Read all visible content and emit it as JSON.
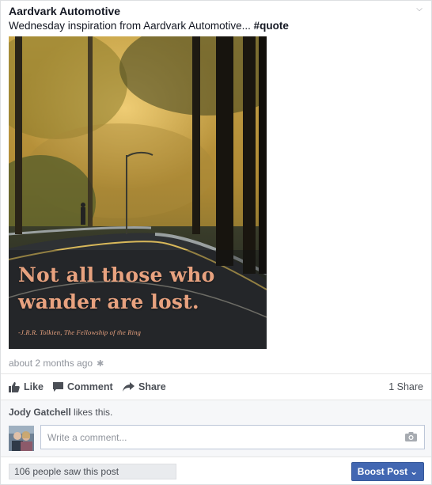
{
  "post": {
    "page_name": "Aardvark Automotive",
    "caption_text": "Wednesday inspiration from Aardvark Automotive... ",
    "caption_hashtag": "#quote",
    "options_icon": "chevron-down-icon",
    "photo": {
      "quote_line_1": "Not all those who",
      "quote_line_2": "wander are lost.",
      "attribution": "-J.R.R. Tolkien, The Fellowship of the Ring",
      "quote_color": "#e8a27f"
    },
    "timestamp": "about 2 months ago",
    "audience_icon": "gear-icon"
  },
  "actions": {
    "like_label": "Like",
    "comment_label": "Comment",
    "share_label": "Share",
    "share_count": "1 Share"
  },
  "feedback": {
    "liker_name": "Jody Gatchell",
    "likes_suffix": " likes this.",
    "comment_placeholder": "Write a comment...",
    "camera_icon": "camera-icon"
  },
  "footer": {
    "reach_text": "106 people saw this post",
    "boost_label": "Boost Post",
    "boost_color": "#4267b2"
  }
}
